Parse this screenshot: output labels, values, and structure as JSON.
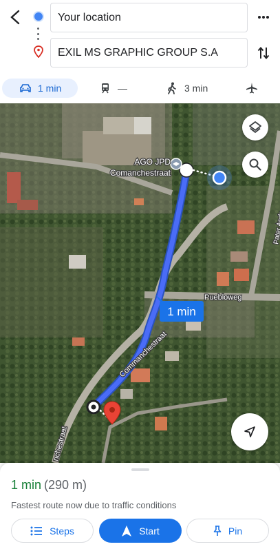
{
  "header": {
    "origin_value": "Your location",
    "destination_value": "EXIL MS GRAPHIC GROUP S.A",
    "icons": [
      "back-arrow-icon",
      "more-vert-icon",
      "swap-vert-icon",
      "location-pin-icon"
    ]
  },
  "modes": {
    "drive": {
      "label": "1 min",
      "icon": "car-icon",
      "selected": true
    },
    "transit": {
      "label": "—",
      "icon": "train-icon"
    },
    "walk": {
      "label": "3 min",
      "icon": "walk-icon"
    },
    "flight": {
      "icon": "airplane-icon"
    }
  },
  "map": {
    "place_label_line1": "AGO JPD",
    "place_label_line2": "Comanchestraat",
    "route_bubble": "1 min",
    "street_pueblo": "Puebloweg",
    "street_comanche": "Commanchestraat",
    "street_comanche_lower": "nchestraat",
    "street_pater": "Pater Andr",
    "route_color": "#4a6cf7",
    "icons": [
      "layers-icon",
      "search-icon",
      "my-location-icon",
      "school-icon",
      "destination-marker-icon"
    ]
  },
  "sheet": {
    "time": "1 min",
    "distance": "(290 m)",
    "note": "Fastest route now due to traffic conditions",
    "steps_label": "Steps",
    "start_label": "Start",
    "pin_label": "Pin"
  }
}
